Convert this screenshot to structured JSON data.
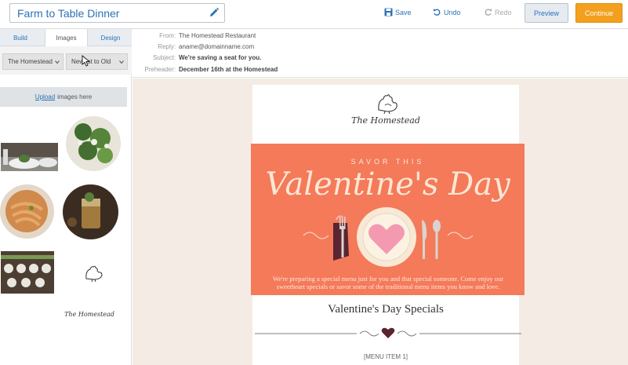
{
  "toolbar": {
    "campaign_title": "Farm to Table Dinner",
    "save_label": "Save",
    "undo_label": "Undo",
    "redo_label": "Redo",
    "preview_label": "Preview",
    "continue_label": "Continue"
  },
  "left_panel": {
    "tabs": [
      {
        "label": "Build",
        "active": false
      },
      {
        "label": "Images",
        "active": true
      },
      {
        "label": "Design",
        "active": false
      }
    ],
    "folder_select": "The Homestead",
    "sort_select": "Newest to Old",
    "upload": {
      "link_text": "Upload",
      "rest_text": "images here"
    },
    "thumbnail_logo_text": "The Homestead"
  },
  "email_header": {
    "from_label": "From:",
    "from_value": "The Homestead Restaurant",
    "reply_label": "Reply:",
    "reply_value": "aname@domainname.com",
    "subject_label": "Subject:",
    "subject_value": "We're saving a seat for you.",
    "preheader_label": "Preheader:",
    "preheader_value": "December 16th at the Homestead"
  },
  "email": {
    "logo_text": "The Homestead",
    "savor_text": "SAVOR THIS",
    "headline": "Valentine's Day",
    "body_text": "We're preparing a special menu just for you and that special someone. Come enjoy our sweetheart specials or savor some of the traditional menu items you know and love.",
    "section_title": "Valentine's Day Specials",
    "menu_item_1": "[MENU ITEM 1]"
  },
  "colors": {
    "accent_blue": "#2a72b8",
    "continue_orange": "#f2a01e",
    "banner_coral": "#f47a5a",
    "canvas_bg": "#f4ece4",
    "heart_dark": "#5a2430"
  },
  "icons": [
    "pencil-icon",
    "save-icon",
    "undo-icon",
    "redo-icon",
    "chevron-down-icon",
    "rooster-icon",
    "heart-icon",
    "fork-icon",
    "knife-icon",
    "spoon-icon",
    "plate-icon",
    "mouse-cursor-icon"
  ]
}
